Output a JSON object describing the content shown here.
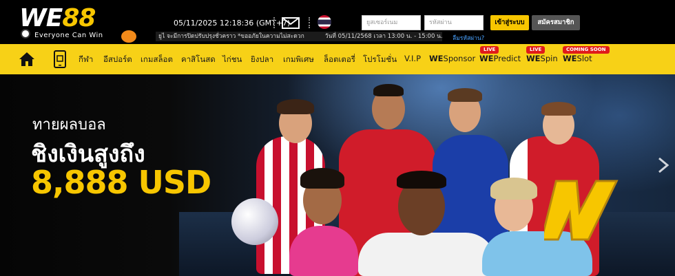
{
  "brand": {
    "logo_text_a": "WE",
    "logo_text_b": "88",
    "tagline": "Everyone Can Win"
  },
  "header": {
    "datetime": "05/11/2025 12:18:36",
    "timezone": "(GMT+7)",
    "marquee_text": "ยูไ จะมีการปิดปรับปรุงชั่วคราว *ขออภัยในความไม่สะดวก",
    "marquee_datetime": "วันที่ 05/11/2568 เวลา 13:00 น. - 15:00 น.",
    "username_placeholder": "ยูสเซอร์เนม",
    "password_placeholder": "รหัสผ่าน",
    "forgot_password": "ลืมรหัสผ่าน?",
    "login_label": "เข้าสู่ระบบ",
    "register_label": "สมัครสมาชิก",
    "icons": [
      "mail-icon",
      "thai-flag-icon"
    ]
  },
  "nav": {
    "icons": [
      "home-icon",
      "mobile-app-icon"
    ],
    "items": [
      {
        "label": "กีฬา"
      },
      {
        "label": "อีสปอร์ต"
      },
      {
        "label": "เกมสล็อต"
      },
      {
        "label": "คาสิโนสด"
      },
      {
        "label": "ไก่ชน"
      },
      {
        "label": "ยิงปลา"
      },
      {
        "label": "เกมพิเศษ"
      },
      {
        "label": "ล็อตเตอรี่"
      },
      {
        "label": "โปรโมชั่น"
      },
      {
        "label": "V.I.P"
      }
    ],
    "brand_items": [
      {
        "prefix": "WE",
        "suffix": "Sponsor",
        "badge": ""
      },
      {
        "prefix": "WE",
        "suffix": "Predict",
        "badge": "LIVE"
      },
      {
        "prefix": "WE",
        "suffix": "Spin",
        "badge": "LIVE"
      },
      {
        "prefix": "WE",
        "suffix": "Slot",
        "badge": "COMING SOON"
      }
    ]
  },
  "banner": {
    "line1": "ทายผลบอล",
    "line2": "ชิงเงินสูงถึง",
    "prize": "8,888 USD",
    "colors": {
      "accent": "#f7c600",
      "nav_bg": "#f7d117"
    }
  }
}
